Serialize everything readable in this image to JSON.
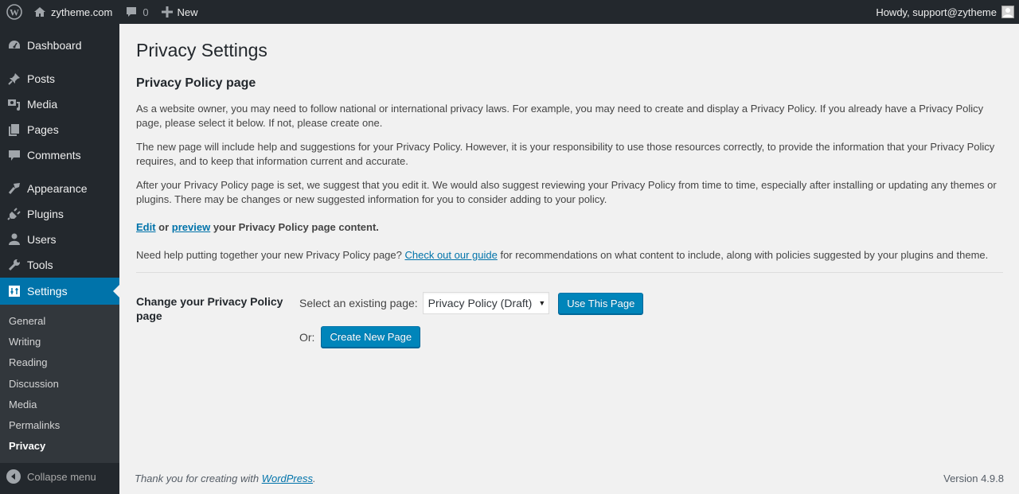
{
  "adminbar": {
    "site_name": "zytheme.com",
    "comments_count": "0",
    "new_label": "New",
    "howdy": "Howdy, support@zytheme"
  },
  "sidebar": {
    "items": [
      {
        "label": "Dashboard",
        "icon": "dashboard-icon"
      },
      {
        "label": "Posts",
        "icon": "pushpin-icon"
      },
      {
        "label": "Media",
        "icon": "media-icon"
      },
      {
        "label": "Pages",
        "icon": "pages-icon"
      },
      {
        "label": "Comments",
        "icon": "comment-icon"
      },
      {
        "label": "Appearance",
        "icon": "paintbrush-icon"
      },
      {
        "label": "Plugins",
        "icon": "plug-icon"
      },
      {
        "label": "Users",
        "icon": "user-icon"
      },
      {
        "label": "Tools",
        "icon": "wrench-icon"
      },
      {
        "label": "Settings",
        "icon": "sliders-icon"
      }
    ],
    "submenu": [
      "General",
      "Writing",
      "Reading",
      "Discussion",
      "Media",
      "Permalinks",
      "Privacy"
    ],
    "collapse_label": "Collapse menu"
  },
  "main": {
    "page_title": "Privacy Settings",
    "section_title": "Privacy Policy page",
    "para1": "As a website owner, you may need to follow national or international privacy laws. For example, you may need to create and display a Privacy Policy. If you already have a Privacy Policy page, please select it below. If not, please create one.",
    "para2": "The new page will include help and suggestions for your Privacy Policy. However, it is your responsibility to use those resources correctly, to provide the information that your Privacy Policy requires, and to keep that information current and accurate.",
    "para3": "After your Privacy Policy page is set, we suggest that you edit it. We would also suggest reviewing your Privacy Policy from time to time, especially after installing or updating any themes or plugins. There may be changes or new suggested information for you to consider adding to your policy.",
    "edit_link": "Edit",
    "or_text": " or ",
    "preview_link": "preview",
    "edit_suffix": " your Privacy Policy page content.",
    "help_prefix": "Need help putting together your new Privacy Policy page? ",
    "guide_link": "Check out our guide",
    "help_suffix": " for recommendations on what content to include, along with policies suggested by your plugins and theme.",
    "form": {
      "row_label": "Change your Privacy Policy page",
      "select_label": "Select an existing page:",
      "select_value": "Privacy Policy (Draft)",
      "use_button": "Use This Page",
      "or_label": "Or:",
      "create_button": "Create New Page"
    }
  },
  "footer": {
    "thanks_prefix": "Thank you for creating with ",
    "wordpress_link": "WordPress",
    "thanks_suffix": ".",
    "version": "Version 4.9.8"
  },
  "colors": {
    "accent": "#0073aa",
    "button": "#0085ba",
    "sidebar_bg": "#23282d",
    "submenu_bg": "#32373c",
    "page_bg": "#f1f1f1"
  }
}
